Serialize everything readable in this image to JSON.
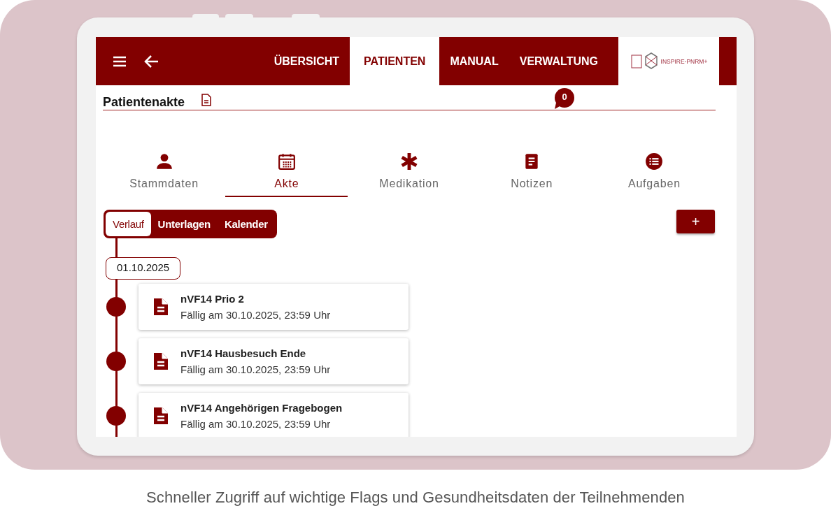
{
  "header": {
    "nav": [
      {
        "label": "ÜBERSICHT",
        "selected": false
      },
      {
        "label": "PATIENTEN",
        "selected": true
      },
      {
        "label": "MANUAL",
        "selected": false
      },
      {
        "label": "VERWALTUNG",
        "selected": false
      }
    ],
    "logo_text": "INSPIRE-PNRM+"
  },
  "page_title": "Patientenakte",
  "message_count": "0",
  "tabs": [
    {
      "label": "Stammdaten",
      "kind": "person",
      "selected": false
    },
    {
      "label": "Akte",
      "kind": "calendar",
      "selected": true
    },
    {
      "label": "Medikation",
      "kind": "asterisk",
      "selected": false
    },
    {
      "label": "Notizen",
      "kind": "note",
      "selected": false
    },
    {
      "label": "Aufgaben",
      "kind": "list",
      "selected": false
    }
  ],
  "segments": [
    {
      "label": "Verlauf",
      "selected": true
    },
    {
      "label": "Unterlagen",
      "selected": false
    },
    {
      "label": "Kalender",
      "selected": false
    }
  ],
  "add_button": "+",
  "timeline": {
    "date": "01.10.2025",
    "items": [
      {
        "title": "nVF14 Prio 2",
        "due": "Fällig am 30.10.2025, 23:59 Uhr"
      },
      {
        "title": "nVF14 Hausbesuch Ende",
        "due": "Fällig am 30.10.2025, 23:59 Uhr"
      },
      {
        "title": "nVF14 Angehörigen Fragebogen",
        "due": "Fällig am 30.10.2025, 23:59 Uhr"
      }
    ]
  },
  "caption": "Schneller Zugriff auf wichtige Flags und Gesundheitsdaten der Teilnehmenden"
}
